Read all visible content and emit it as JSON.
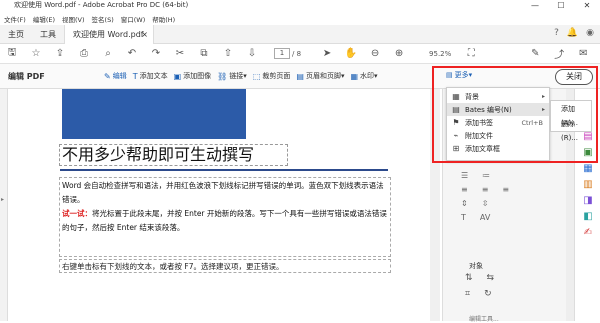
{
  "window": {
    "title": "欢迎使用 Word.pdf - Adobe Acrobat Pro DC (64-bit)",
    "controls": [
      "—",
      "☐",
      "✕"
    ]
  },
  "menu": [
    "文件(F)",
    "编辑(E)",
    "视图(V)",
    "签名(S)",
    "窗口(W)",
    "帮助(H)"
  ],
  "tabs": {
    "home": "主页",
    "tools": "工具",
    "doc": "欢迎使用 Word.pdf",
    "close": "×"
  },
  "toolbar": {
    "page_current": "1",
    "page_total": "/ 8",
    "zoom": "95.2%"
  },
  "editbar": {
    "label": "编辑 PDF",
    "tools": [
      {
        "label": "编辑",
        "icon": "✎"
      },
      {
        "label": "添加文本",
        "icon": "T"
      },
      {
        "label": "添加图像",
        "icon": "▣"
      },
      {
        "label": "链接▾",
        "icon": "⛓"
      },
      {
        "label": "裁剪页面",
        "icon": "⬚"
      },
      {
        "label": "页眉和页脚▾",
        "icon": "▤"
      },
      {
        "label": "水印▾",
        "icon": "▦"
      }
    ],
    "more": "更多▾",
    "close": "关闭"
  },
  "document": {
    "headline": "不用多少帮助即可生动撰写",
    "para1": "Word 会自动检查拼写和语法，并用红色波浪下划线标记拼写错误的单词。蓝色双下划线表示语法错误。",
    "tip_label": "试一试：",
    "tip_text": "将光标置于此段末尾，并按 Enter 开始新的段落。写下一个具有一些拼写错误或语法错误的句子，然后按 Enter 结束该段落。",
    "para3": "右键单击标有下划线的文本，或者按 F7。选择建议项，更正错误。"
  },
  "dropdown": {
    "items": [
      {
        "label": "背景",
        "icon": "▦",
        "arrow": "▸",
        "shortcut": ""
      },
      {
        "label": "Bates 编号(N)",
        "icon": "▤",
        "arrow": "▸",
        "shortcut": ""
      },
      {
        "label": "添加书签",
        "icon": "🔖",
        "arrow": "",
        "shortcut": "Ctrl+B"
      },
      {
        "label": "附加文件",
        "icon": "📎",
        "arrow": "",
        "shortcut": ""
      },
      {
        "label": "添加文章框",
        "icon": "⊞",
        "arrow": "",
        "shortcut": ""
      }
    ],
    "submenu": [
      "添加(A)...",
      "删除(R)..."
    ]
  },
  "rightpane": {
    "object_label": "对象",
    "edit_picture": "编辑工具..."
  },
  "colors": {
    "accent": "#1a5fb4",
    "highlight": "#e22222",
    "rail": [
      "#e02b5c",
      "#c83dba",
      "#3c8a3c",
      "#2d6fd1",
      "#d87a1c",
      "#7a4fd6",
      "#2aa2a0",
      "#d64545"
    ]
  }
}
